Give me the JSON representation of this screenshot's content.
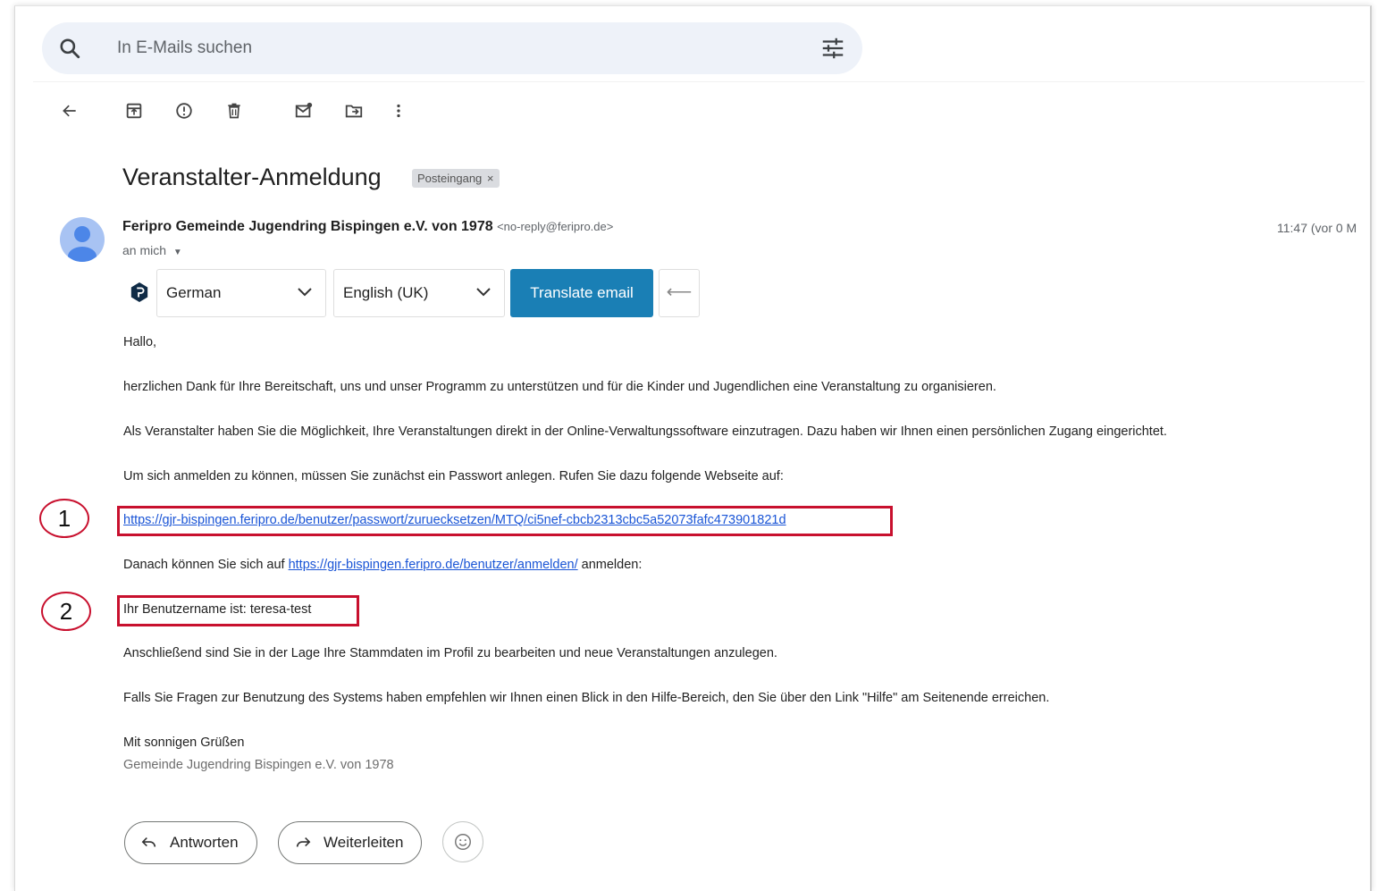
{
  "search": {
    "placeholder": "In E-Mails suchen"
  },
  "message": {
    "subject": "Veranstalter-Anmeldung",
    "label": "Posteingang",
    "sender_name": "Feripro Gemeinde Jugendring Bispingen e.V. von 1978",
    "sender_email": "<no-reply@feripro.de>",
    "to_me": "an mich",
    "time": "11:47 (vor 0 M"
  },
  "translate": {
    "source_lang": "German",
    "target_lang": "English (UK)",
    "button": "Translate email",
    "swap_glyph": "⟵"
  },
  "email_body": {
    "greeting": "Hallo,",
    "para1": "herzlichen Dank für Ihre Bereitschaft, uns und unser Programm zu unterstützen und für die Kinder und Jugendlichen eine Veranstaltung zu organisieren.",
    "para2": "Als Veranstalter haben Sie die Möglichkeit, Ihre Veranstaltungen direkt in der Online-Verwaltungssoftware einzutragen. Dazu haben wir Ihnen einen persönlichen Zugang eingerichtet.",
    "para3": "Um sich anmelden zu können, müssen Sie zunächst ein Passwort anlegen. Rufen Sie dazu folgende Webseite auf:",
    "reset_link": "https://gjr-bispingen.feripro.de/benutzer/passwort/zuruecksetzen/MTQ/ci5nef-cbcb2313cbc5a52073fafc473901821d",
    "para4_before": "Danach können Sie sich auf ",
    "login_link": "https://gjr-bispingen.feripro.de/benutzer/anmelden/",
    "para4_after": " anmelden:",
    "username_line": "Ihr Benutzername ist: teresa-test",
    "para5": "Anschließend sind Sie in der Lage Ihre Stammdaten im Profil zu bearbeiten und neue Veranstaltungen anzulegen.",
    "para6": "Falls Sie Fragen zur Benutzung des Systems haben empfehlen wir Ihnen einen Blick in den Hilfe-Bereich, den Sie über den Link \"Hilfe\" am Seitenende erreichen.",
    "closing": "Mit sonnigen Grüßen",
    "signature": "Gemeinde Jugendring Bispingen e.V. von 1978"
  },
  "annotations": {
    "one": "1",
    "two": "2"
  },
  "actions": {
    "reply": "Antworten",
    "forward": "Weiterleiten"
  },
  "colors": {
    "highlight": "#c8102e",
    "translate_button": "#1a7fb5",
    "link": "#1a55d6"
  },
  "icons": [
    "search-icon",
    "tune-icon",
    "back-arrow-icon",
    "archive-icon",
    "report-spam-icon",
    "delete-icon",
    "mark-unread-icon",
    "move-to-icon",
    "more-vert-icon",
    "translator-logo-icon",
    "chevron-down-icon",
    "reply-icon",
    "forward-icon",
    "emoji-icon"
  ]
}
